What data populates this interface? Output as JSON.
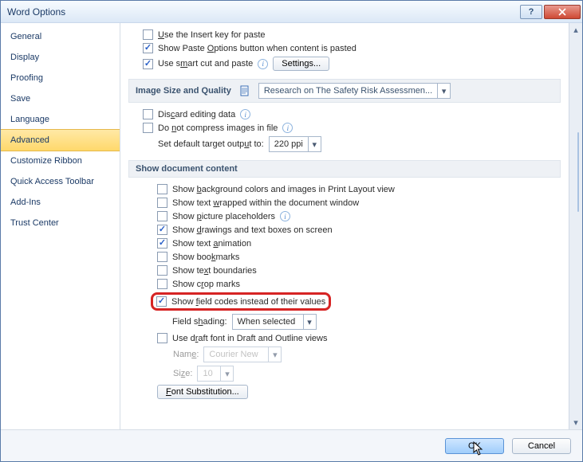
{
  "window": {
    "title": "Word Options"
  },
  "sidebar": {
    "items": [
      {
        "label": "General"
      },
      {
        "label": "Display"
      },
      {
        "label": "Proofing"
      },
      {
        "label": "Save"
      },
      {
        "label": "Language"
      },
      {
        "label": "Advanced"
      },
      {
        "label": "Customize Ribbon"
      },
      {
        "label": "Quick Access Toolbar"
      },
      {
        "label": "Add-Ins"
      },
      {
        "label": "Trust Center"
      }
    ],
    "selected_index": 5
  },
  "cutpaste": {
    "use_insert_key": "Use the Insert key for paste",
    "show_paste_options": "Show Paste Options button when content is pasted",
    "smart_cut_paste": "Use smart cut and paste",
    "settings_btn": "Settings..."
  },
  "image_section": {
    "header": "Image Size and Quality",
    "doc_combo": "Research on The Safety Risk Assessmen...",
    "discard": "Discard editing data",
    "no_compress": "Do not compress images in file",
    "target_output_label": "Set default target output to:",
    "target_output_value": "220 ppi"
  },
  "doc_content": {
    "header": "Show document content",
    "bg_colors": "Show background colors and images in Print Layout view",
    "text_wrapped": "Show text wrapped within the document window",
    "picture_placeholders": "Show picture placeholders",
    "drawings": "Show drawings and text boxes on screen",
    "text_animation": "Show text animation",
    "bookmarks": "Show bookmarks",
    "text_boundaries": "Show text boundaries",
    "crop_marks": "Show crop marks",
    "field_codes": "Show field codes instead of their values",
    "field_shading_label": "Field shading:",
    "field_shading_value": "When selected",
    "draft_font": "Use draft font in Draft and Outline views",
    "name_label": "Name:",
    "name_value": "Courier New",
    "size_label": "Size:",
    "size_value": "10",
    "font_sub_btn": "Font Substitution..."
  },
  "footer": {
    "ok": "OK",
    "cancel": "Cancel"
  }
}
